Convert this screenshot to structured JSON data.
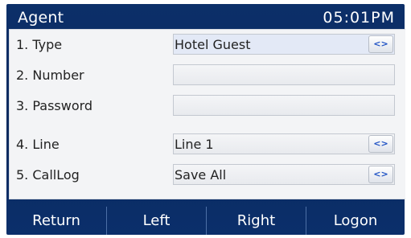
{
  "header": {
    "title": "Agent",
    "time": "05:01PM"
  },
  "form": {
    "rows": [
      {
        "label": "1. Type",
        "value": "Hotel Guest",
        "switch_icon": "left-right-arrows-icon",
        "switch_glyph": "<>"
      },
      {
        "label": "2. Number",
        "value": ""
      },
      {
        "label": "3. Password",
        "value": ""
      },
      {
        "label": "4. Line",
        "value": "Line 1",
        "switch_icon": "left-right-arrows-icon",
        "switch_glyph": "<>"
      },
      {
        "label": "5. CallLog",
        "value": "Save All",
        "switch_icon": "left-right-arrows-icon",
        "switch_glyph": "<>"
      }
    ]
  },
  "softkeys": [
    {
      "label": "Return"
    },
    {
      "label": "Left"
    },
    {
      "label": "Right"
    },
    {
      "label": "Logon"
    }
  ],
  "colors": {
    "screen_bg": "#0c2f69",
    "panel_bg": "#f3f4f6",
    "switch_accent": "#1f52c4"
  }
}
